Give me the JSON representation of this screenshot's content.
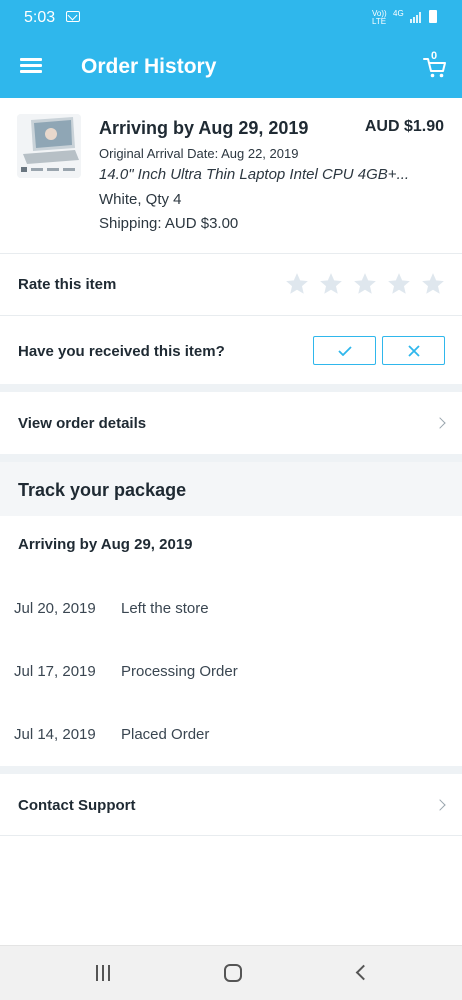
{
  "status_bar": {
    "time": "5:03",
    "network_label": "Vo)) LTE",
    "data_label": "4G"
  },
  "app_bar": {
    "title": "Order History",
    "cart_count": "0"
  },
  "order": {
    "arriving": "Arriving by Aug 29, 2019",
    "price": "AUD $1.90",
    "original_arrival": "Original Arrival Date: Aug 22, 2019",
    "product_name": "14.0\" Inch Ultra Thin Laptop Intel CPU 4GB+...",
    "variant": "White, Qty 4",
    "shipping": "Shipping: AUD $3.00"
  },
  "rating": {
    "label": "Rate this item",
    "current_rating": 0,
    "max_rating": 5
  },
  "received": {
    "label": "Have you received this item?"
  },
  "view_details": {
    "label": "View order details"
  },
  "tracking": {
    "title": "Track your package",
    "arriving": "Arriving by Aug 29, 2019",
    "events": [
      {
        "date": "Jul 20, 2019",
        "description": "Left the store"
      },
      {
        "date": "Jul 17, 2019",
        "description": "Processing Order"
      },
      {
        "date": "Jul 14, 2019",
        "description": "Placed Order"
      }
    ]
  },
  "support": {
    "label": "Contact Support"
  },
  "colors": {
    "primary": "#2fb7ec",
    "star_empty": "#dfe7ee",
    "text_dark": "#1f2a33"
  }
}
